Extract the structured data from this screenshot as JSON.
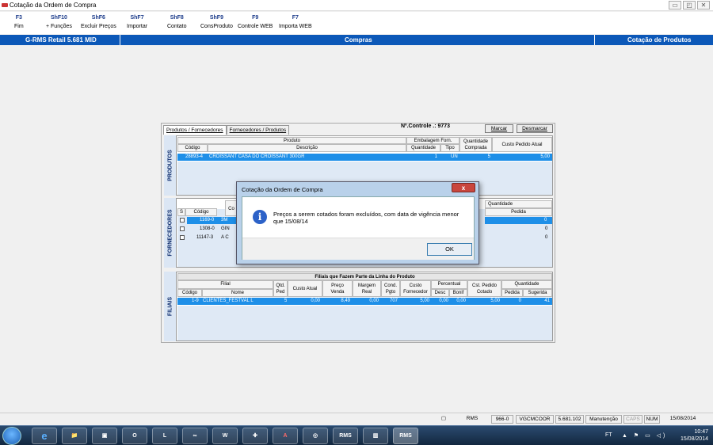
{
  "window": {
    "title": "Cotação da Ordem de Compra",
    "controls": [
      "▭",
      "◰",
      "✕"
    ]
  },
  "function_keys": [
    {
      "key": "F3",
      "label": "Fim"
    },
    {
      "key": "ShF10",
      "label": "+ Funções"
    },
    {
      "key": "ShF6",
      "label": "Excluir Preços"
    },
    {
      "key": "ShF7",
      "label": "Importar"
    },
    {
      "key": "ShF8",
      "label": "Contato"
    },
    {
      "key": "ShF9",
      "label": "ConsProduto"
    },
    {
      "key": "F9",
      "label": "Controle WEB"
    },
    {
      "key": "F7",
      "label": "Importa WEB"
    }
  ],
  "header": {
    "app_name": "G-RMS Retail 5.681 MID",
    "module": "Compras",
    "screen": "Cotação de Produtos"
  },
  "tabs": [
    {
      "label": "Produtos / Fornecedores"
    },
    {
      "label": "Fornecedores / Produtos"
    }
  ],
  "control": {
    "text": "Nº.Controle .: 9773"
  },
  "buttons": {
    "marcar": "Marcar",
    "desmarcar": "Desmarcar"
  },
  "produtos": {
    "side_label": "PRODUTOS",
    "group_produto": "Produto",
    "group_embalagem": "Embalagem Forn.",
    "col_codigo": "Código",
    "col_descricao": "Descrição",
    "col_quantidade": "Quantidade",
    "col_tipo": "Tipo",
    "col_qtd_comprada": "Quantidade Comprada",
    "col_custo_pedido": "Custo Pedido Atual",
    "row": {
      "codigo": "28893-4",
      "descricao": "CROISSANT CASA DO CROISSANT 300GR",
      "quantidade": "1",
      "tipo": "UN",
      "comprada": "5",
      "custo": "5,00"
    }
  },
  "fornecedores": {
    "side_label": "FORNECEDORES",
    "col_s": "S",
    "col_codigo": "Código",
    "col_co": "Co",
    "col_quantidade": "Quantidade",
    "col_pedida": "Pedida",
    "rows": [
      {
        "codigo": "1169-0",
        "nome": "3M",
        "pedida": "0",
        "selected": true
      },
      {
        "codigo": "1308-0",
        "nome": "GIN",
        "pedida": "0",
        "selected": false
      },
      {
        "codigo": "11147-3",
        "nome": "A C",
        "pedida": "0",
        "selected": false
      }
    ]
  },
  "filiais": {
    "side_label": "FILIAIS",
    "title": "Filiais que Fazem Parte da Linha do Produto",
    "group_filial": "Filial",
    "col_codigo": "Código",
    "col_nome": "Nome",
    "col_qtd_ped": "Qtd. Ped",
    "col_custo_atual": "Custo Atual",
    "col_preco_venda": "Preço Venda",
    "col_margem": "Margem Real",
    "col_cond": "Cond. Pgto",
    "col_custo_forn": "Custo Fornecedor",
    "group_percentual": "Percentual",
    "col_desc": "Desc",
    "col_bonif": "Bonif",
    "col_cst_pedido": "Cst. Pedido Cotado",
    "group_quantidade": "Quantidade",
    "col_pedida": "Pedida",
    "col_sugerida": "Sugerida",
    "row": {
      "codigo": "1-9",
      "nome": "CLIENTES_FESTVAL L",
      "qtd_ped": "5",
      "custo_atual": "0,00",
      "preco_venda": "8,49",
      "margem": "0,00",
      "cond": "707",
      "custo_forn": "5,00",
      "desc": "0,00",
      "bonif": "0,00",
      "cst_pedido": "5,00",
      "pedida": "0",
      "sugerida": "41"
    }
  },
  "dialog": {
    "title": "Cotação da Ordem de Compra",
    "close": "x",
    "message": "Preços a serem cotados foram excluídos, com data de vigência menor que 15/08/14",
    "ok": "OK"
  },
  "statusbar": [
    {
      "text": "RMS"
    },
    {
      "text": "966-0"
    },
    {
      "text": "VGCMCOOR"
    },
    {
      "text": "5.681.102"
    },
    {
      "text": "Manutenção"
    },
    {
      "text": "CAPS"
    },
    {
      "text": "NUM"
    },
    {
      "text": "15/08/2014"
    }
  ],
  "taskbar": {
    "apps": [
      "e",
      "📁",
      "▣",
      "O",
      "L",
      "∞",
      "W",
      "✚",
      "A",
      "◎",
      "RMS",
      "▥",
      "RMS"
    ],
    "tray_label": "FT",
    "tray_icons": "▲ ⚑ ▭ ◁)",
    "time": "10:47",
    "date": "15/08/2014"
  },
  "colors": {
    "accent_blue": "#0c58b8",
    "selection": "#1e8fe8",
    "grid_bg": "#dfe9f5"
  }
}
